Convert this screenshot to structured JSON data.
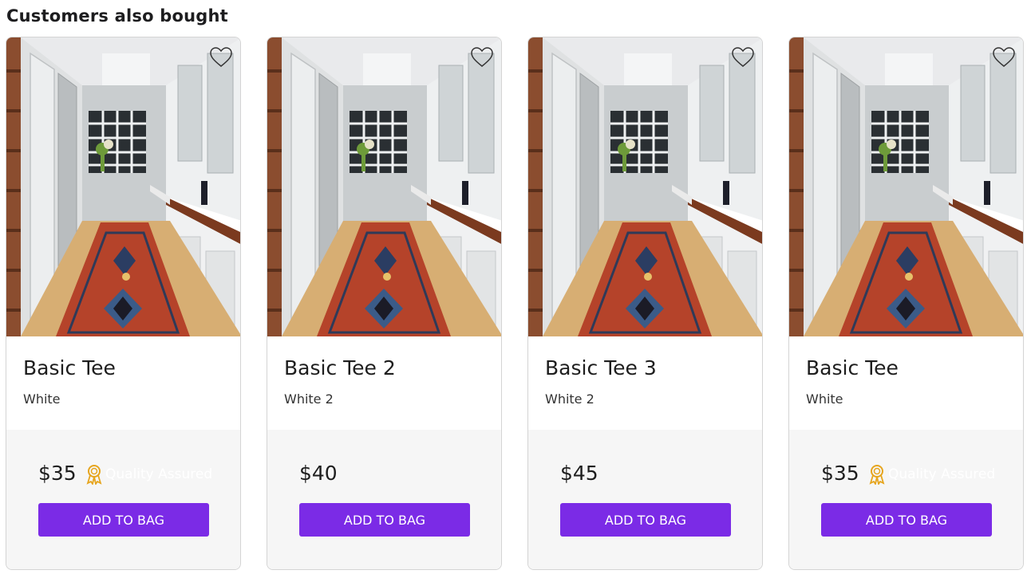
{
  "section": {
    "title": "Customers also bought"
  },
  "products": [
    {
      "name": "Basic Tee",
      "color": "White",
      "price": "$35",
      "badge": "Quality Assured",
      "button": "ADD TO BAG"
    },
    {
      "name": "Basic Tee 2",
      "color": "White 2",
      "price": "$40",
      "badge": "",
      "button": "ADD TO BAG"
    },
    {
      "name": "Basic Tee 3",
      "color": "White 2",
      "price": "$45",
      "badge": "",
      "button": "ADD TO BAG"
    },
    {
      "name": "Basic Tee",
      "color": "White",
      "price": "$35",
      "badge": "Quality Assured",
      "button": "ADD TO BAG"
    }
  ],
  "icons": {
    "wishlist": "heart-outline-icon",
    "badge": "award-ribbon-icon"
  },
  "colors": {
    "accent": "#7b2be6",
    "badge_icon": "#e6a51e",
    "footer_bg": "#f6f6f6"
  }
}
